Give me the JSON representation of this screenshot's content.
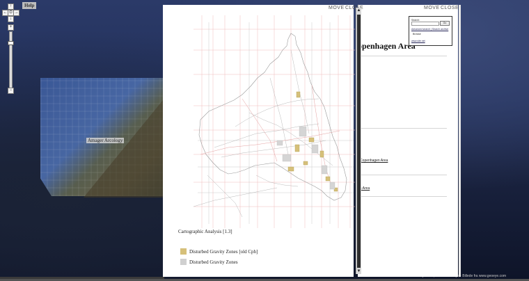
{
  "map": {
    "help_label": "Help",
    "place_label": "Amager Arcology",
    "faded_label": "",
    "credits": "©Kortdata: ©2008 Geodatastyrelsen, ©2010 GeoEye · Billede fra www.geoeye.com",
    "nav_arrows": [
      "↑",
      "←",
      "⊙",
      "→",
      "↓"
    ],
    "zoom_in": "+",
    "zoom_out": "−",
    "zoom_level": 0.18
  },
  "main_panel": {
    "move_label": "MOVE",
    "close_label": "CLOSE",
    "caption": "Cartographic Analysis [1.3]",
    "legend": [
      {
        "label": "Disturbed Gravity Zones [old Cph]",
        "color": "#d6c07a"
      },
      {
        "label": "Disturbed Gravity Zones",
        "color": "#d0d0d0"
      }
    ],
    "scroll_up": "▲",
    "scroll_down": "▼"
  },
  "right_panel": {
    "move_label": "MOVE",
    "close_label": "CLOSE",
    "title": "openhagen Area",
    "links": [
      "r Copenhagen Area",
      "en Area"
    ],
    "search": {
      "label": "Search:",
      "go": "Go",
      "advanced_link": "Advanced search | Search archive",
      "hint": "Browse",
      "archive_link": "www.site.net"
    }
  }
}
